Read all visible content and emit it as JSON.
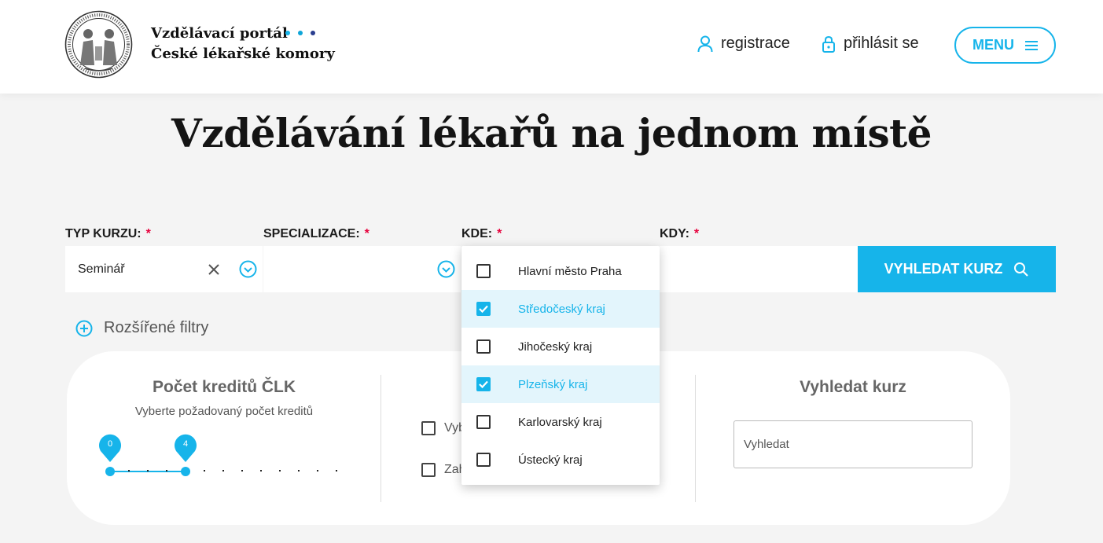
{
  "header": {
    "logo_line1": "Vzdělávací portál",
    "logo_line2": "České lékařské komory",
    "seal_icon": "clk-seal-logo",
    "dot_colors": [
      "#16b4ea",
      "#0ea5d8",
      "#2a3e8f"
    ],
    "register_label": "registrace",
    "login_label": "přihlásit se",
    "menu_label": "MENU"
  },
  "hero_title": "Vzdělávání lékařů na jednom místě",
  "filters": {
    "typ_label": "TYP KURZU:",
    "spec_label": "SPECIALIZACE:",
    "kde_label": "KDE:",
    "kdy_label": "KDY:",
    "required_mark": "*",
    "typ_value": "Seminář",
    "search_button": "VYHLEDAT KURZ"
  },
  "advanced_filters_label": "Rozšířené filtry",
  "panel": {
    "credits_title": "Počet kreditů ČLK",
    "credits_sub": "Vyberte požadovaný počet kreditů",
    "credits_min": "0",
    "credits_max": "4",
    "credits_scale_max": 12,
    "checkbox1_text": "Vyb",
    "checkbox2_text": "Zah",
    "search_title": "Vyhledat kurz",
    "search_placeholder": "Vyhledat"
  },
  "region_dropdown": {
    "items": [
      {
        "label": "Hlavní město Praha",
        "checked": false
      },
      {
        "label": "Středočeský kraj",
        "checked": true
      },
      {
        "label": "Jihočeský kraj",
        "checked": false
      },
      {
        "label": "Plzeňský kraj",
        "checked": true
      },
      {
        "label": "Karlovarský kraj",
        "checked": false
      },
      {
        "label": "Ústecký kraj",
        "checked": false
      }
    ]
  },
  "colors": {
    "accent": "#16b4ea",
    "required": "#e6003c"
  }
}
